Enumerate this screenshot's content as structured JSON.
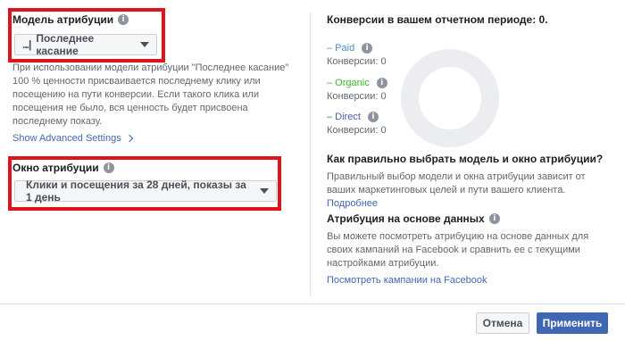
{
  "left": {
    "model_label": "Модель атрибуции",
    "model_dropdown": {
      "prefix": "...|",
      "value": "Последнее касание"
    },
    "description": "При использовании модели атрибуции \"Последнее касание\" 100 % ценности присваивается последнему клику или посещению на пути конверсии. Если такого клика или посещения не было, вся ценность будет присвоена последнему показу.",
    "advanced_link": "Show Advanced Settings",
    "window_label": "Окно атрибуции",
    "window_dropdown": {
      "value": "Клики и посещения за 28 дней, показы за 1 день"
    }
  },
  "right": {
    "conversions_title": "Конверсии в вашем отчетном периоде: 0.",
    "legend": [
      {
        "name": "– Paid",
        "sub": "Конверсии: 0",
        "color": "#4a90c8"
      },
      {
        "name": "– Organic",
        "sub": "Конверсии: 0",
        "color": "#42b72a"
      },
      {
        "name": "– Direct",
        "sub": "Конверсии: 0",
        "color": "#4b5faa"
      }
    ],
    "choose_title": "Как правильно выбрать модель и окно атрибуции?",
    "choose_text": "Правильный выбор модели и окна атрибуции зависит от ваших маркетинговых целей и пути вашего клиента.",
    "choose_link": "Подробнее",
    "data_title": "Атрибуция на основе данных",
    "data_text": "Вы можете посмотреть атрибуцию на основе данных для своих кампаний на Facebook и сравнить ее с текущими настройками атрибуции.",
    "fb_link": "Посмотреть кампании на Facebook"
  },
  "footer": {
    "cancel_label": "Отмена",
    "apply_label": "Применить"
  },
  "icons": {
    "info": "info-icon",
    "caret": "caret-down-icon",
    "chevron": "chevron-right-icon"
  },
  "colors": {
    "accent": "#4267b2",
    "highlight": "#e0121b",
    "donut": "#ebedf0"
  }
}
